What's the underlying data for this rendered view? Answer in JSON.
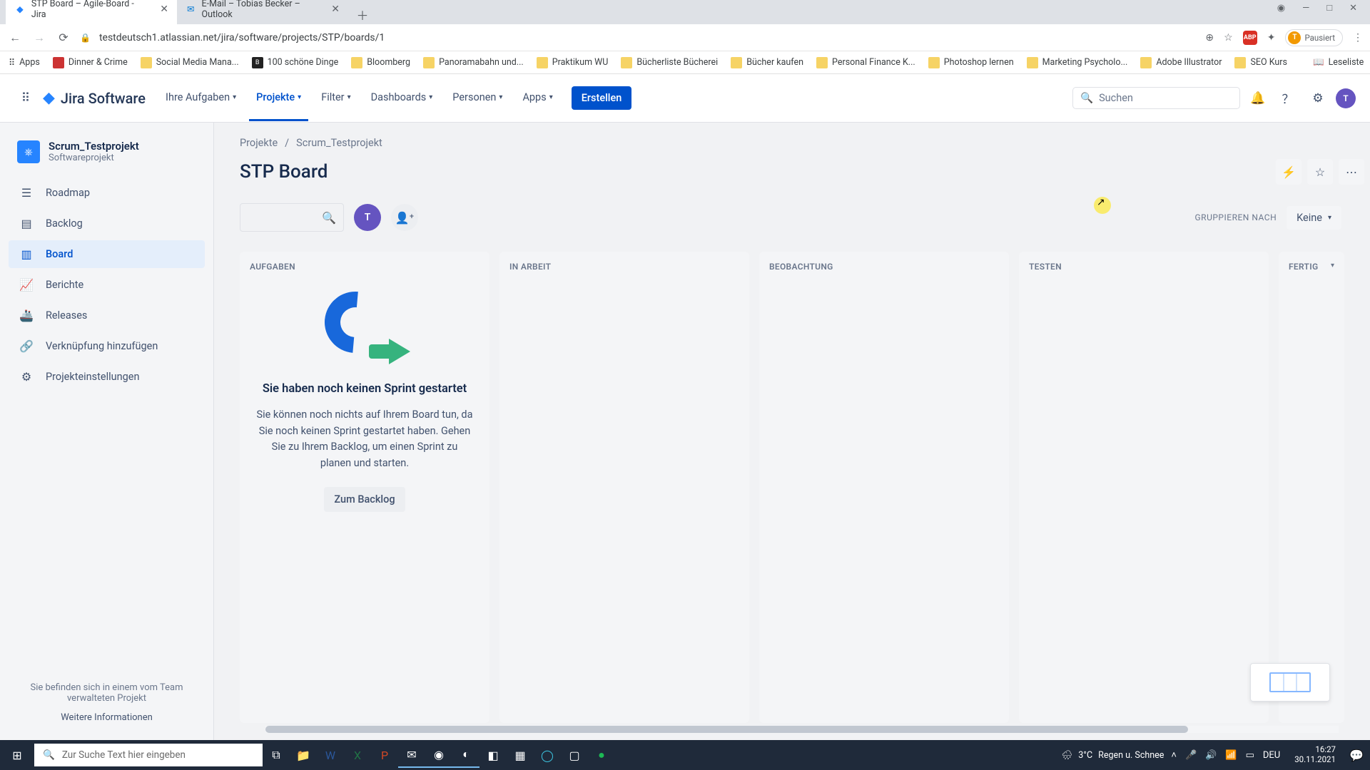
{
  "browser": {
    "tabs": [
      {
        "title": "STP Board – Agile-Board - Jira",
        "active": true
      },
      {
        "title": "E-Mail – Tobias Becker – Outlook",
        "active": false
      }
    ],
    "url": "testdeutsch1.atlassian.net/jira/software/projects/STP/boards/1",
    "pause_label": "Pausiert",
    "pause_initial": "T",
    "bookmarks": [
      "Apps",
      "Dinner & Crime",
      "Social Media Mana...",
      "100 schöne Dinge",
      "Bloomberg",
      "Panoramabahn und...",
      "Praktikum WU",
      "Bücherliste Bücherei",
      "Bücher kaufen",
      "Personal Finance K...",
      "Photoshop lernen",
      "Marketing Psycholo...",
      "Adobe Illustrator",
      "SEO Kurs"
    ],
    "reading_list": "Leseliste"
  },
  "nav": {
    "product": "Jira Software",
    "items": [
      "Ihre Aufgaben",
      "Projekte",
      "Filter",
      "Dashboards",
      "Personen",
      "Apps"
    ],
    "active_index": 1,
    "create": "Erstellen",
    "search_placeholder": "Suchen",
    "avatar_initial": "T"
  },
  "sidebar": {
    "project_name": "Scrum_Testprojekt",
    "project_sub": "Softwareprojekt",
    "items": [
      {
        "icon": "☰",
        "label": "Roadmap"
      },
      {
        "icon": "▤",
        "label": "Backlog"
      },
      {
        "icon": "▥",
        "label": "Board"
      },
      {
        "icon": "📈",
        "label": "Berichte"
      },
      {
        "icon": "🚢",
        "label": "Releases"
      },
      {
        "icon": "🔗",
        "label": "Verknüpfung hinzufügen"
      },
      {
        "icon": "⚙",
        "label": "Projekteinstellungen"
      }
    ],
    "active_index": 2,
    "footer1": "Sie befinden sich in einem vom Team verwalteten Projekt",
    "footer2": "Weitere Informationen"
  },
  "main": {
    "crumb1": "Projekte",
    "crumb2": "Scrum_Testprojekt",
    "title": "STP Board",
    "assignee_initial": "T",
    "group_label": "GRUPPIEREN NACH",
    "group_value": "Keine",
    "columns": [
      "AUFGABEN",
      "IN ARBEIT",
      "BEOBACHTUNG",
      "TESTEN",
      "FERTIG"
    ],
    "empty": {
      "title": "Sie haben noch keinen Sprint gestartet",
      "desc": "Sie können noch nichts auf Ihrem Board tun, da Sie noch keinen Sprint gestartet haben. Gehen Sie zu Ihrem Backlog, um einen Sprint zu planen und starten.",
      "button": "Zum Backlog"
    }
  },
  "taskbar": {
    "search_placeholder": "Zur Suche Text hier eingeben",
    "weather_temp": "3°C",
    "weather_text": "Regen u. Schnee",
    "time": "16:27",
    "date": "30.11.2021",
    "lang": "DEU"
  }
}
